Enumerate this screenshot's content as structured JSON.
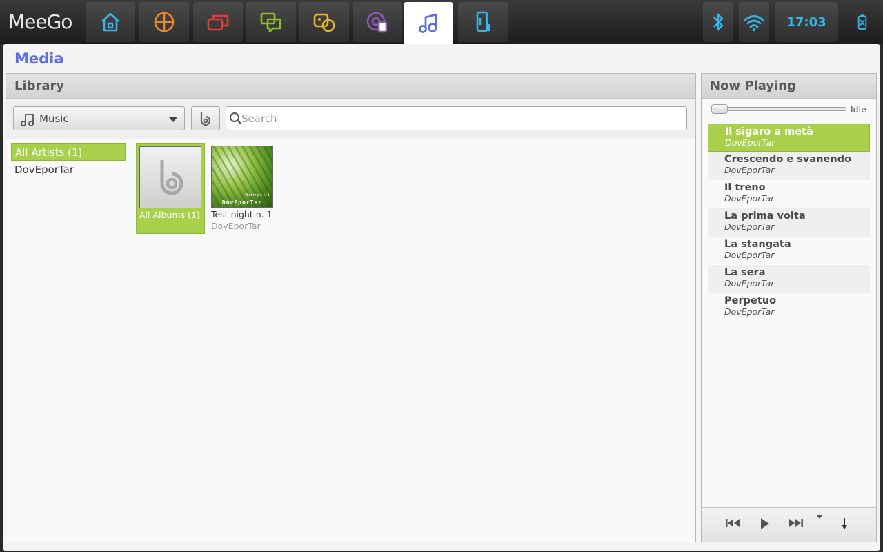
{
  "os": {
    "logo": "MeeGo",
    "clock": "17:03",
    "tabs": [
      {
        "name": "home",
        "icon": "home-icon",
        "color": "#39b4e8"
      },
      {
        "name": "apps",
        "icon": "apps-grid-icon",
        "color": "#e8882a"
      },
      {
        "name": "windows",
        "icon": "windows-icon",
        "color": "#e03a3a"
      },
      {
        "name": "messaging",
        "icon": "chat-icon",
        "color": "#8fbc2a"
      },
      {
        "name": "people",
        "icon": "people-icon",
        "color": "#e8b42a"
      },
      {
        "name": "web",
        "icon": "web-icon",
        "color": "#8a5ab8"
      },
      {
        "name": "media",
        "icon": "music-note-icon",
        "color": "#5b6ee8"
      },
      {
        "name": "devices",
        "icon": "device-icon",
        "color": "#39b4e8"
      }
    ]
  },
  "app": {
    "title": "Media"
  },
  "library": {
    "header": "Library",
    "type_select": "Music",
    "search_placeholder": "Search",
    "artists": [
      "All Artists (1)",
      "DovEporTar"
    ],
    "albums": [
      {
        "title": "All Albums (1)",
        "artist": ""
      },
      {
        "title": "Test night n. 1",
        "artist": "DovEporTar",
        "cover_text": "DovEporTar",
        "cover_subtext": "Test night n. 1"
      }
    ]
  },
  "now_playing": {
    "header": "Now Playing",
    "status": "Idle",
    "progress": 0,
    "tracks": [
      {
        "title": "Il sigaro a metà",
        "artist": "DovEporTar"
      },
      {
        "title": "Crescendo e svanendo",
        "artist": "DovEporTar"
      },
      {
        "title": "Il treno",
        "artist": "DovEporTar"
      },
      {
        "title": "La prima volta",
        "artist": "DovEporTar"
      },
      {
        "title": "La stangata",
        "artist": "DovEporTar"
      },
      {
        "title": "La sera",
        "artist": "DovEporTar"
      },
      {
        "title": "Perpetuo",
        "artist": "DovEporTar"
      }
    ]
  },
  "colors": {
    "accent": "#a8d04a",
    "title": "#5b6ee8",
    "clock": "#39b4e8"
  }
}
